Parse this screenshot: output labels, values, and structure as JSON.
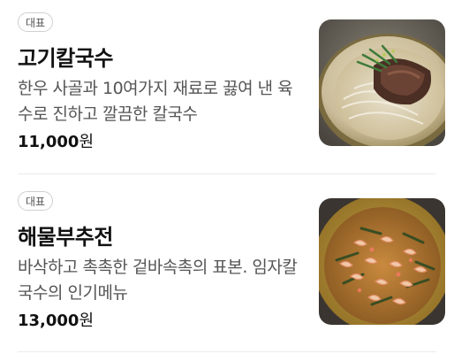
{
  "menu": {
    "items": [
      {
        "badge": "대표",
        "name": "고기칼국수",
        "description": "한우 사골과 10여가지 재료로 끓여 낸 육수로 진하고 깔끔한 칼국수",
        "price": "11,000",
        "currency": "원",
        "photo": "beef-kalguksu-photo"
      },
      {
        "badge": "대표",
        "name": "해물부추전",
        "description": "바삭하고 촉촉한 겉바속촉의 표본. 임자칼국수의 인기메뉴",
        "price": "13,000",
        "currency": "원",
        "photo": "seafood-pancake-photo"
      }
    ]
  },
  "colors": {
    "text": "#111111",
    "description": "#555555",
    "badge_border": "#cfcfcf",
    "divider": "#ececec"
  }
}
